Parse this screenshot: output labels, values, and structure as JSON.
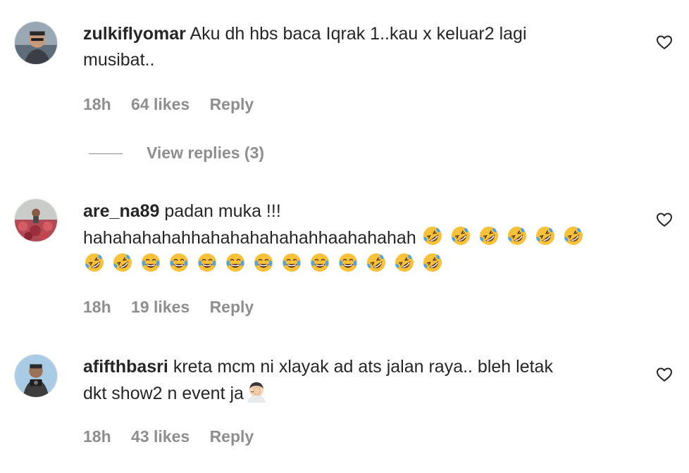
{
  "comments": [
    {
      "username": "zulkiflyomar",
      "text_line1": "Aku dh hbs baca Iqrak 1..kau x keluar2 lagi",
      "text_line2": "musibat..",
      "time": "18h",
      "likes": "64 likes",
      "reply": "Reply",
      "view_replies": "View replies (3)"
    },
    {
      "username": "are_na89",
      "text_line1": "padan muka !!!",
      "text_line2": "hahahahahahhahahahahahahhaahahahah",
      "emojis_line2": [
        "rofl",
        "rofl",
        "rofl",
        "rofl",
        "rofl",
        "rofl"
      ],
      "emojis_line3": [
        "rofl",
        "rofl",
        "joy",
        "joy",
        "joy",
        "joy",
        "joy",
        "joy",
        "joy",
        "joy",
        "rofl",
        "rofl",
        "rofl"
      ],
      "time": "18h",
      "likes": "19 likes",
      "reply": "Reply"
    },
    {
      "username": "afifthbasri",
      "text_line1": "kreta mcm ni xlayak ad ats jalan raya.. bleh letak",
      "text_line2": "dkt show2 n event ja",
      "time": "18h",
      "likes": "43 likes",
      "reply": "Reply"
    }
  ],
  "colors": {
    "text": "#262626",
    "secondary": "#8e8e8e",
    "emoji": "#f7c23a"
  }
}
